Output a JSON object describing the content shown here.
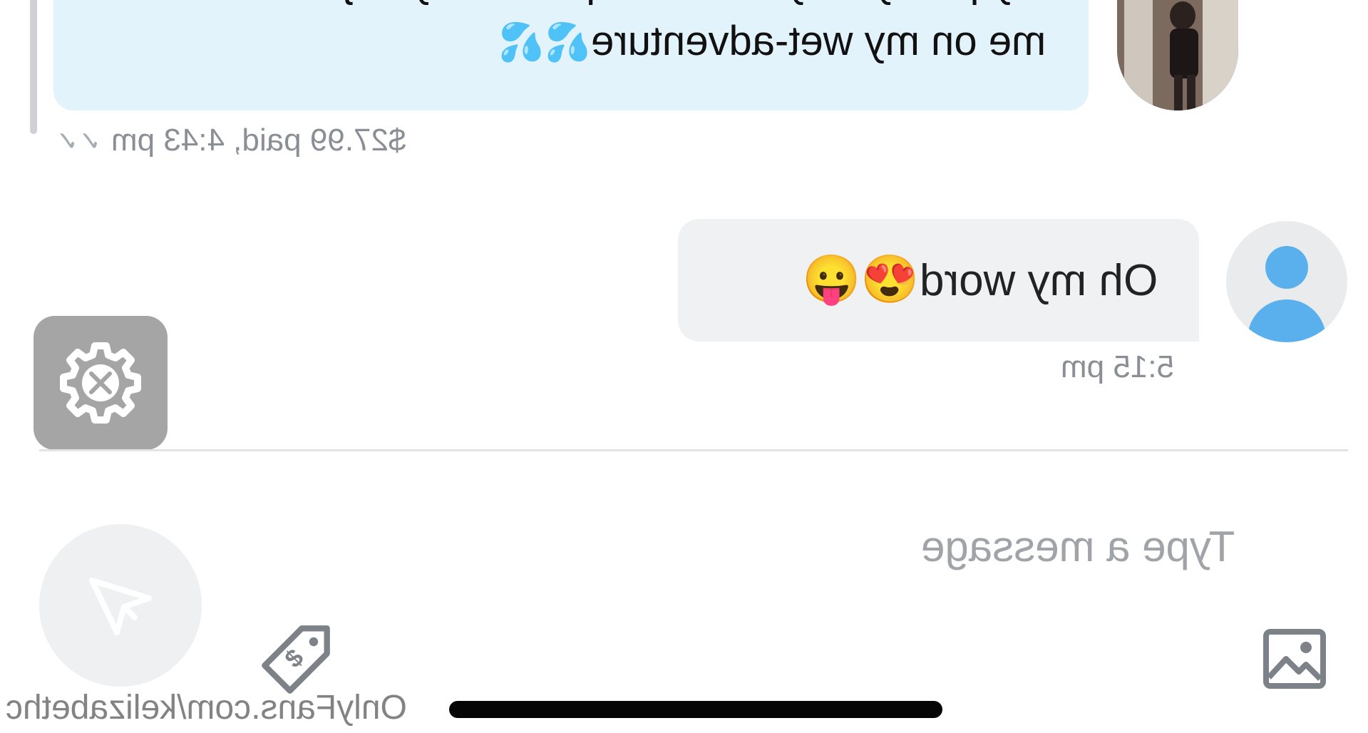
{
  "thread": {
    "paid_message": {
      "text_line_1": "my pussy only lets one special boy to join",
      "text_line_2": "me on my wet-adventure",
      "emoji": "💦💦",
      "meta": "$27.99 paid, 4:43 pm",
      "status_icon": "double-check-icon"
    },
    "own_message": {
      "text": "Oh my word",
      "emoji": "😍😛",
      "time": "5:15 pm"
    }
  },
  "composer": {
    "placeholder": "Type a message"
  },
  "watermark": "OnlyFans.com/kelizabethc",
  "icons": {
    "settings": "settings-tools-icon",
    "send": "send-icon",
    "price": "price-tag-icon",
    "media": "image-icon"
  },
  "colors": {
    "paid_bubble": "#e3f3fc",
    "own_bubble": "#f0f1f3",
    "avatar_accent": "#5ab0ec",
    "settings_bg": "#a5a5a5"
  }
}
